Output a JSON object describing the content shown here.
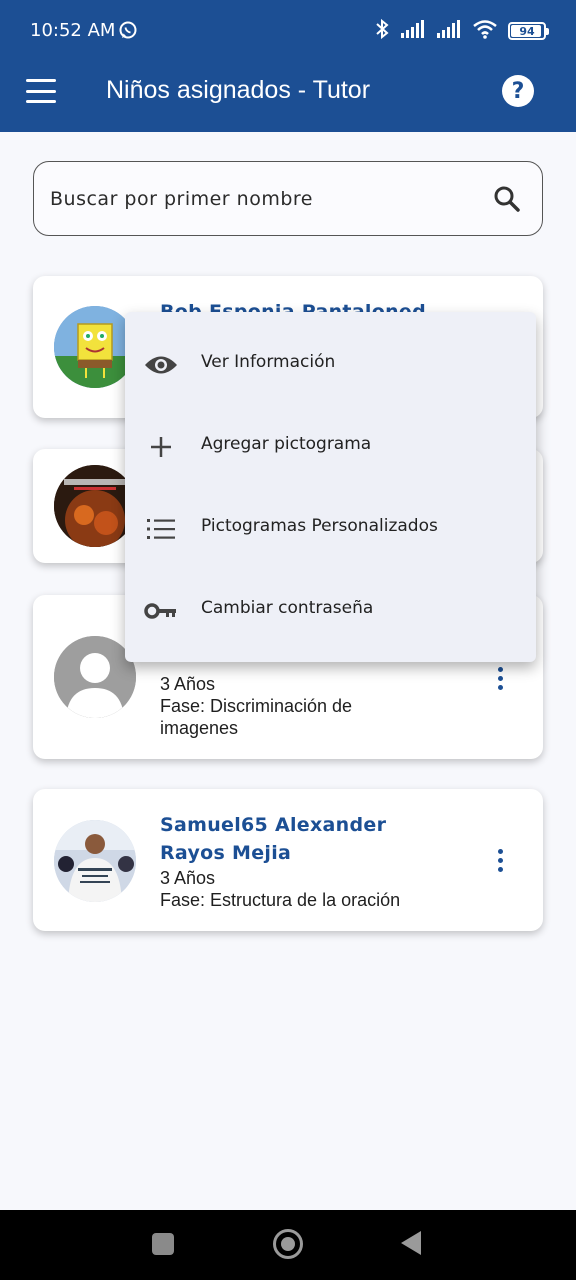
{
  "status_bar": {
    "time": "10:52 AM",
    "battery": "94",
    "battery_level": 0.94
  },
  "app_bar": {
    "title": "Niños asignados - Tutor",
    "menu_icon": "hamburger-menu-icon",
    "help_icon": "help-icon",
    "help_glyph": "?"
  },
  "search": {
    "placeholder": "Buscar por primer nombre",
    "icon": "search-icon"
  },
  "children": [
    {
      "name_line1": "Bob Esponja Pantaloned",
      "name_line2": "",
      "age": "",
      "phase": ""
    },
    {
      "name_line1": "",
      "name_line2": "",
      "age": "",
      "phase": ""
    },
    {
      "name_line1": "",
      "name_line2": "",
      "age": "3 Años",
      "phase_line1": "Fase: Discriminación de",
      "phase_line2": "imagenes"
    },
    {
      "name_line1": "Samuel65 Alexander",
      "name_line2": "Rayos Mejia",
      "age": "3 Años",
      "phase": "Fase: Estructura de la oración"
    }
  ],
  "context_menu": {
    "items": [
      {
        "label": "Ver Información",
        "icon": "eye-icon"
      },
      {
        "label": "Agregar pictograma",
        "icon": "plus-icon"
      },
      {
        "label": "Pictogramas Personalizados",
        "icon": "list-icon"
      },
      {
        "label": "Cambiar contraseña",
        "icon": "key-icon"
      }
    ]
  },
  "colors": {
    "primary": "#1c4f94",
    "background": "#f7f8fc",
    "menu_background": "#eef0f7"
  }
}
